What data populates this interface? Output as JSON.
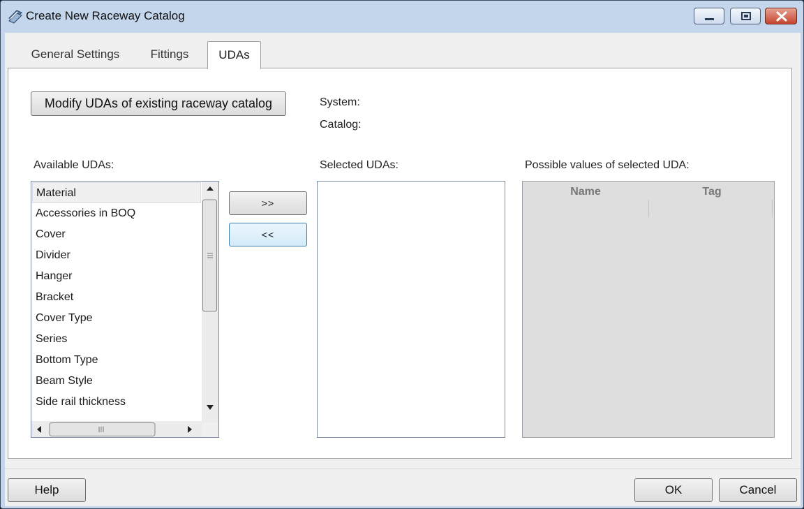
{
  "window": {
    "title": "Create New Raceway Catalog"
  },
  "tabs": [
    {
      "label": "General Settings"
    },
    {
      "label": "Fittings"
    },
    {
      "label": "UDAs"
    }
  ],
  "udas_tab": {
    "modify_button": "Modify UDAs of existing raceway catalog",
    "system_label": "System:",
    "catalog_label": "Catalog:",
    "available_label": "Available UDAs:",
    "selected_label": "Selected UDAs:",
    "possible_values_label": "Possible values of selected UDA:",
    "add_button": ">>",
    "remove_button": "<<",
    "available_items": [
      "Material",
      "Accessories in BOQ",
      "Cover",
      "Divider",
      "Hanger",
      "Bracket",
      "Cover Type",
      "Series",
      "Bottom Type",
      "Beam Style",
      "Side rail thickness"
    ],
    "grid_columns": [
      "Name",
      "Tag"
    ]
  },
  "footer": {
    "help_button": "Help",
    "ok_button": "OK",
    "cancel_button": "Cancel"
  }
}
